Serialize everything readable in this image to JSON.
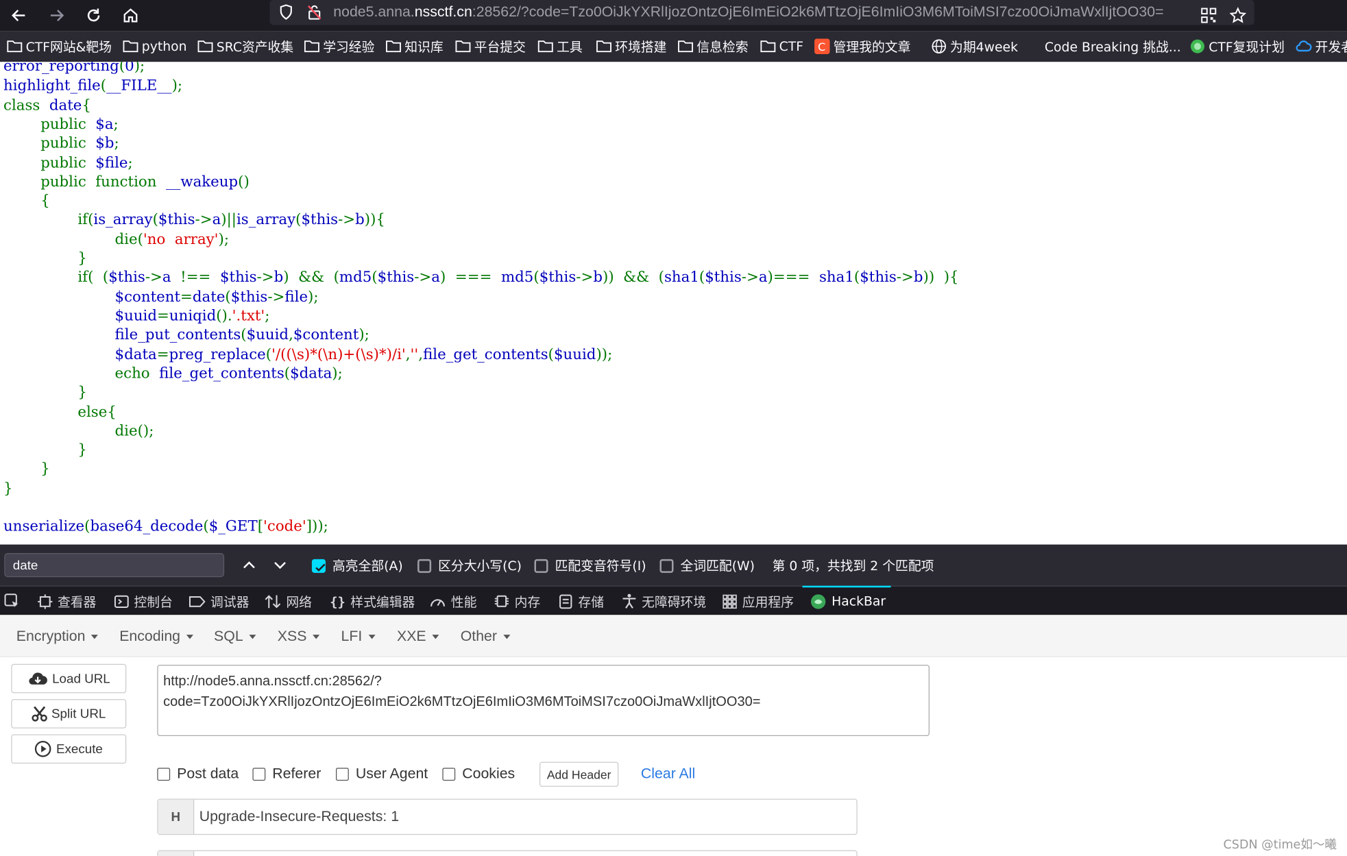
{
  "browser": {
    "url_prefix": "node5.anna.",
    "url_domain": "nssctf.cn",
    "url_rest": ":28562/?code=Tzo0OiJkYXRlIjozOntzOjE6ImEiO2k6MTtzOjE6ImIiO3M6MToiMSI7czo0OiJmaWxlIjtOO30="
  },
  "bookmarks": [
    {
      "label": "CTF网站&靶场",
      "icon": "folder-icon"
    },
    {
      "label": "python",
      "icon": "folder-icon"
    },
    {
      "label": "SRC资产收集",
      "icon": "folder-icon"
    },
    {
      "label": "学习经验",
      "icon": "folder-icon"
    },
    {
      "label": "知识库",
      "icon": "folder-icon"
    },
    {
      "label": "平台提交",
      "icon": "folder-icon"
    },
    {
      "label": "工具",
      "icon": "folder-icon"
    },
    {
      "label": "环境搭建",
      "icon": "folder-icon"
    },
    {
      "label": "信息检索",
      "icon": "folder-icon"
    },
    {
      "label": "CTF",
      "icon": "folder-icon"
    },
    {
      "label": "管理我的文章",
      "icon": "csdn-icon"
    },
    {
      "label": "为期4week",
      "icon": "globe-icon"
    },
    {
      "label": "Code Breaking 挑战...",
      "icon": "blank-icon"
    },
    {
      "label": "CTF复现计划",
      "icon": "green-circle-icon"
    },
    {
      "label": "开发者",
      "icon": "cloud-icon"
    }
  ],
  "code": {
    "l1a": "error_reporting",
    "l1b": "(",
    "l1c": "0",
    "l1d": ");",
    "l2a": "highlight_file",
    "l2b": "(",
    "l2c": "__FILE__",
    "l2d": ");",
    "l3a": "class  ",
    "l3b": "date",
    "l3c": "{",
    "l4a": "        public  ",
    "l4b": "$a",
    "l4c": ";",
    "l5a": "        public  ",
    "l5b": "$b",
    "l5c": ";",
    "l6a": "        public  ",
    "l6b": "$file",
    "l6c": ";",
    "l7a": "        public  function  ",
    "l7b": "__wakeup",
    "l7c": "()",
    "l8a": "        {",
    "l9a": "                if(",
    "l9b": "is_array",
    "l9c": "(",
    "l9d": "$this",
    "l9e": "->",
    "l9f": "a",
    "l9g": ")||",
    "l9h": "is_array",
    "l9i": "(",
    "l9j": "$this",
    "l9k": "->",
    "l9l": "b",
    "l9m": ")){",
    "l10a": "                        die(",
    "l10b": "'no  array'",
    "l10c": ");",
    "l11a": "                }",
    "l12a": "                if(  (",
    "l12b": "$this",
    "l12c": "->",
    "l12d": "a",
    "l12e": "  !==  ",
    "l12f": "$this",
    "l12g": "->",
    "l12h": "b",
    "l12i": ")  &&  (",
    "l12j": "md5",
    "l12k": "(",
    "l12l": "$this",
    "l12m": "->",
    "l12n": "a",
    "l12o": ")  ===  ",
    "l12p": "md5",
    "l12q": "(",
    "l12r": "$this",
    "l12s": "->",
    "l12t": "b",
    "l12u": "))  &&  (",
    "l12v": "sha1",
    "l12w": "(",
    "l12x": "$this",
    "l12y": "->",
    "l12z": "a",
    "l12aa": ")===  ",
    "l12ab": "sha1",
    "l12ac": "(",
    "l12ad": "$this",
    "l12ae": "->",
    "l12af": "b",
    "l12ag": "))  ){",
    "l13a": "                        ",
    "l13b": "$content",
    "l13c": "=",
    "l13d": "date",
    "l13e": "(",
    "l13f": "$this",
    "l13g": "->",
    "l13h": "file",
    "l13i": ");",
    "l14a": "                        ",
    "l14b": "$uuid",
    "l14c": "=",
    "l14d": "uniqid",
    "l14e": "().",
    "l14f": "'.txt'",
    "l14g": ";",
    "l15a": "                        ",
    "l15b": "file_put_contents",
    "l15c": "(",
    "l15d": "$uuid",
    "l15e": ",",
    "l15f": "$content",
    "l15g": ");",
    "l16a": "                        ",
    "l16b": "$data",
    "l16c": "=",
    "l16d": "preg_replace",
    "l16e": "(",
    "l16f": "'/((\\s)*(\\n)+(\\s)*)/i'",
    "l16g": ",",
    "l16h": "''",
    "l16i": ",",
    "l16j": "file_get_contents",
    "l16k": "(",
    "l16l": "$uuid",
    "l16m": "));",
    "l17a": "                        echo  ",
    "l17b": "file_get_contents",
    "l17c": "(",
    "l17d": "$data",
    "l17e": ");",
    "l18a": "                }",
    "l19a": "                else{",
    "l20a": "                        die();",
    "l21a": "                }",
    "l22a": "        }",
    "l23a": "}",
    "l24a": "unserialize",
    "l24b": "(",
    "l24c": "base64_decode",
    "l24d": "(",
    "l24e": "$_GET",
    "l24f": "[",
    "l24g": "'code'",
    "l24h": "]));"
  },
  "findbar": {
    "query": "date",
    "highlight_all": "高亮全部(A)",
    "match_case": "区分大小写(C)",
    "match_diacritics": "匹配变音符号(I)",
    "whole_words": "全词匹配(W)",
    "status": "第 0 项，共找到 2 个匹配项"
  },
  "devtools": {
    "tabs": [
      "查看器",
      "控制台",
      "调试器",
      "网络",
      "样式编辑器",
      "性能",
      "内存",
      "存储",
      "无障碍环境",
      "应用程序",
      "HackBar"
    ]
  },
  "hackbar": {
    "menus": [
      "Encryption",
      "Encoding",
      "SQL",
      "XSS",
      "LFI",
      "XXE",
      "Other"
    ],
    "load_url": "Load URL",
    "split_url": "Split URL",
    "execute": "Execute",
    "url_value": "http://node5.anna.nssctf.cn:28562/?\ncode=Tzo0OiJkYXRlIjozOntzOjE6ImEiO2k6MTtzOjE6ImIiO3M6MToiMSI7czo0OiJmaWxlIjtOO30=",
    "post_data": "Post data",
    "referer": "Referer",
    "user_agent": "User Agent",
    "cookies": "Cookies",
    "add_header": "Add Header",
    "clear_all": "Clear All",
    "header_label": "H",
    "header_value": "Upgrade-Insecure-Requests: 1"
  },
  "watermark": "CSDN @time如～曦"
}
